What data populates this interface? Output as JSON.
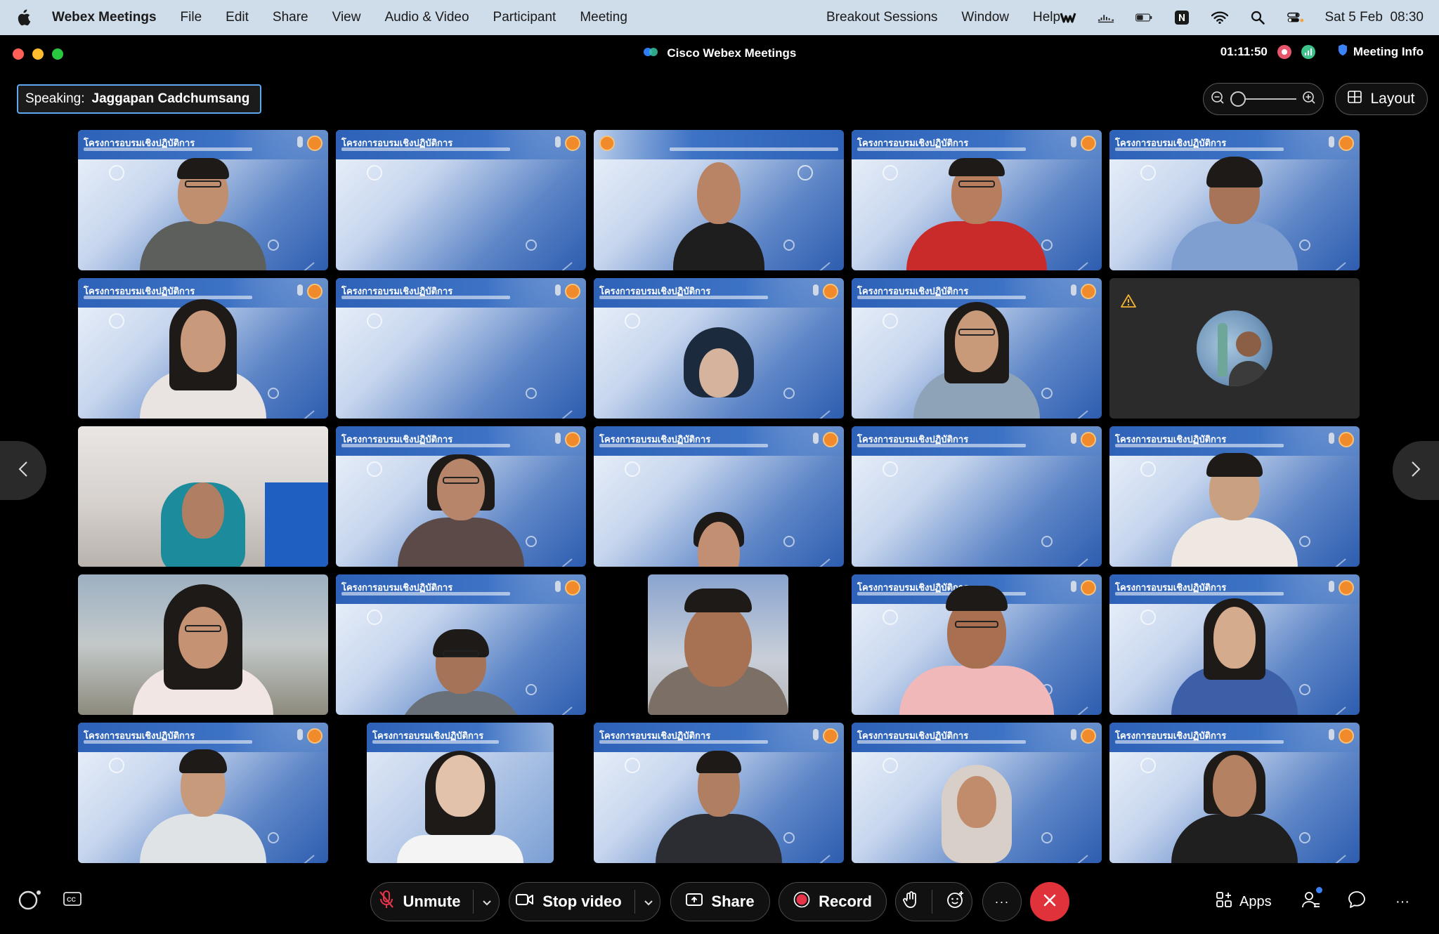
{
  "menubar": {
    "app_name": "Webex Meetings",
    "menus": [
      "File",
      "Edit",
      "Share",
      "View",
      "Audio & Video",
      "Participant",
      "Meeting"
    ],
    "right_menus": [
      "Breakout Sessions",
      "Window",
      "Help"
    ],
    "datetime": "Sat 5 Feb  08:30",
    "icons": [
      "webex-icon",
      "wave-icon",
      "battery-icon",
      "notion-icon",
      "wifi-icon",
      "search-icon",
      "control-center-icon"
    ]
  },
  "window": {
    "title": "Cisco Webex Meetings",
    "timer": "01:11:50",
    "meeting_info": "Meeting Info"
  },
  "speaking": {
    "label": "Speaking:",
    "name": "Jaggapan Cadchumsang"
  },
  "layout_button": {
    "label": "Layout"
  },
  "tile_banner_text": "โครงการอบรมเชิงปฏิบัติการ",
  "toolbar": {
    "unmute": "Unmute",
    "stop_video": "Stop video",
    "share": "Share",
    "record": "Record",
    "more": "···",
    "apps": "Apps"
  },
  "colors": {
    "menubar_bg": "#cfdcea",
    "speaking_border": "#5fa7ee",
    "end_call": "#e0323b",
    "record_red": "#e5334a"
  }
}
